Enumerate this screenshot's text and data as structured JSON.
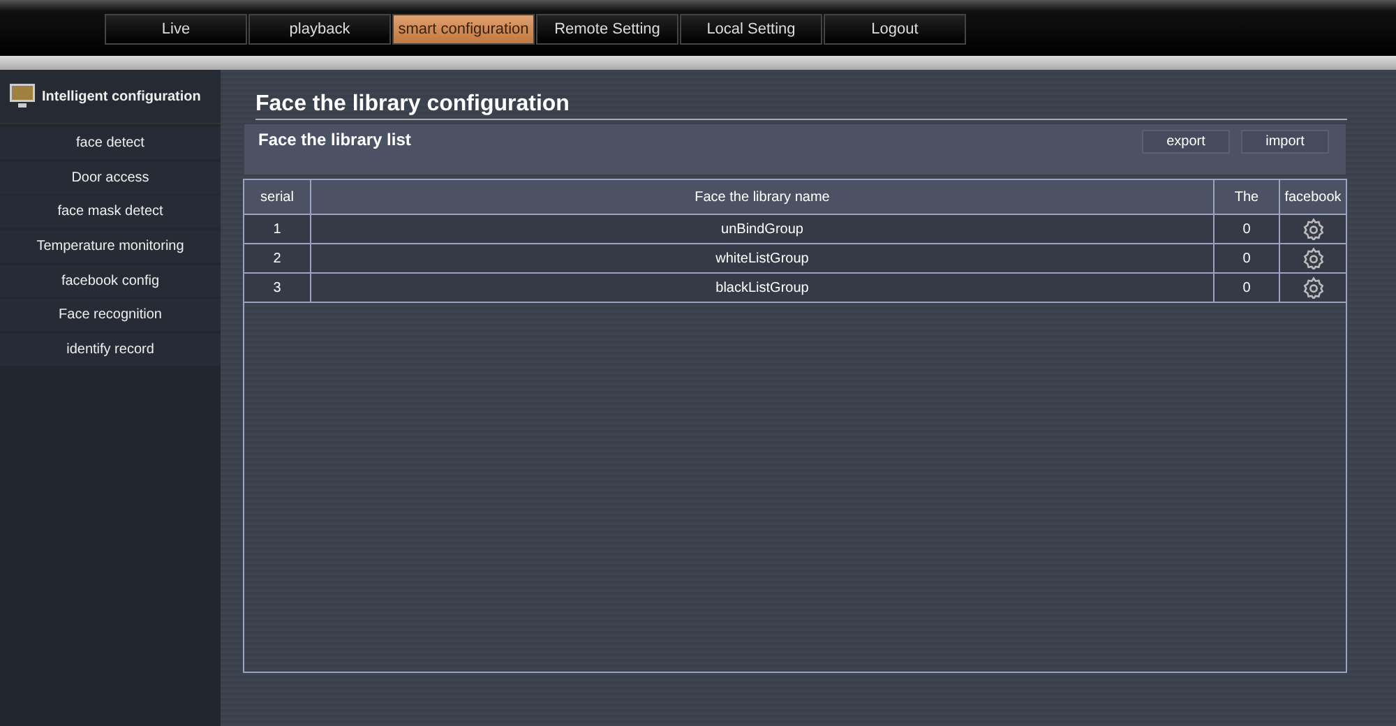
{
  "nav": [
    {
      "label": "Live",
      "selected": false
    },
    {
      "label": "playback",
      "selected": false
    },
    {
      "label": "smart configuration",
      "selected": true
    },
    {
      "label": "Remote Setting",
      "selected": false
    },
    {
      "label": "Local Setting",
      "selected": false
    },
    {
      "label": "Logout",
      "selected": false
    }
  ],
  "sidebar": {
    "title": "Intelligent configuration",
    "items": [
      "face detect",
      "Door access",
      "face mask detect",
      "Temperature monitoring",
      "facebook config",
      "Face recognition",
      "identify record"
    ]
  },
  "page_title": "Face the library configuration",
  "panel": {
    "title": "Face the library list",
    "buttons": [
      "export",
      "import"
    ]
  },
  "table": {
    "columns": [
      "serial",
      "Face the library name",
      "The",
      "facebook"
    ],
    "rows": [
      {
        "serial": "1",
        "name": "unBindGroup",
        "count": "0"
      },
      {
        "serial": "2",
        "name": "whiteListGroup",
        "count": "0"
      },
      {
        "serial": "3",
        "name": "blackListGroup",
        "count": "0"
      }
    ]
  }
}
